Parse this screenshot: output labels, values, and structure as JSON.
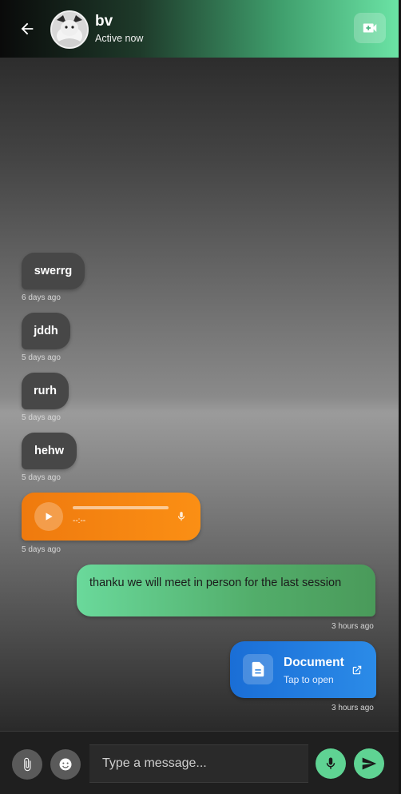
{
  "header": {
    "contact_name": "bv",
    "status": "Active now"
  },
  "icons": {
    "back": "arrow-left-icon",
    "video": "video-call-icon",
    "play": "play-icon",
    "mic": "mic-icon",
    "document": "file-icon",
    "open": "external-link-icon",
    "attach": "paperclip-icon",
    "emoji": "smiley-icon",
    "send": "send-icon"
  },
  "colors": {
    "accent": "#5fd393",
    "audio": "#f58410",
    "document": "#2080e0"
  },
  "messages": {
    "m1": {
      "text": "swerrg",
      "time": "6 days ago"
    },
    "m2": {
      "text": "jddh",
      "time": "5 days ago"
    },
    "m3": {
      "text": "rurh",
      "time": "5 days ago"
    },
    "m4": {
      "text": "hehw",
      "time": "5 days ago"
    },
    "audio": {
      "duration": "--:--",
      "time": "5 days ago"
    },
    "m5": {
      "text": "thanku we will meet in person for the last session",
      "time": "3 hours ago"
    },
    "doc": {
      "title": "Document",
      "subtitle": "Tap to open",
      "time": "3 hours ago"
    }
  },
  "composer": {
    "placeholder": "Type a message..."
  }
}
